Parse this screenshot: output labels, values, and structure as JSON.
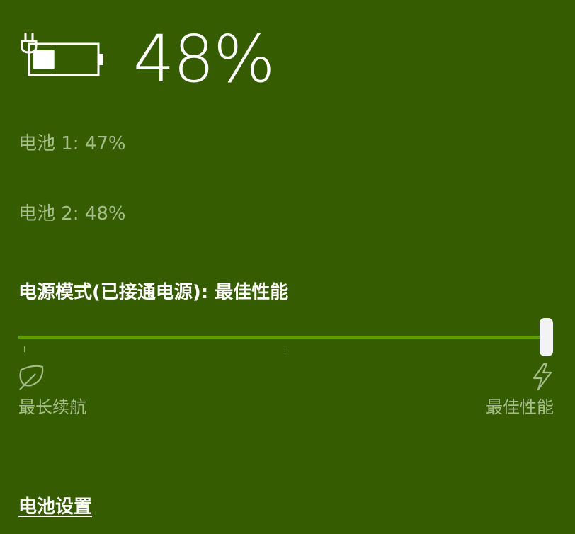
{
  "battery": {
    "percent_label": "48%",
    "charge_level": 0.48,
    "plugged_in": true,
    "batteries": [
      {
        "label": "电池 1: 47%"
      },
      {
        "label": "电池 2: 48%"
      }
    ]
  },
  "power_mode": {
    "title": "电源模式(已接通电源): 最佳性能",
    "slider_value": 1.0,
    "left_label": "最长续航",
    "right_label": "最佳性能",
    "left_icon": "leaf-icon",
    "right_icon": "lightning-bolt-icon"
  },
  "settings_link": "电池设置",
  "colors": {
    "background": "#365c00",
    "track": "#5e9c00",
    "muted_text": "#a5bd8a",
    "thumb": "#f3f3f3"
  }
}
